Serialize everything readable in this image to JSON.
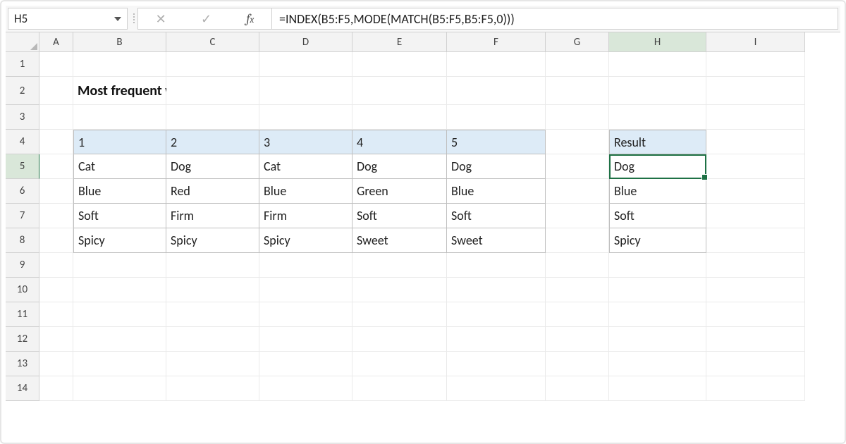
{
  "nameBox": "H5",
  "formula": "=INDEX(B5:F5,MODE(MATCH(B5:F5,B5:F5,0)))",
  "title": "Most frequent word or text",
  "columns": [
    "A",
    "B",
    "C",
    "D",
    "E",
    "F",
    "G",
    "H",
    "I"
  ],
  "activeColumn": "H",
  "rows": [
    "1",
    "2",
    "3",
    "4",
    "5",
    "6",
    "7",
    "8",
    "9",
    "10",
    "11",
    "12",
    "13",
    "14"
  ],
  "activeRow": "5",
  "dataHeaders": [
    "1",
    "2",
    "3",
    "4",
    "5"
  ],
  "data": [
    [
      "Cat",
      "Dog",
      "Cat",
      "Dog",
      "Dog"
    ],
    [
      "Blue",
      "Red",
      "Blue",
      "Green",
      "Blue"
    ],
    [
      "Soft",
      "Firm",
      "Firm",
      "Soft",
      "Soft"
    ],
    [
      "Spicy",
      "Spicy",
      "Spicy",
      "Sweet",
      "Sweet"
    ]
  ],
  "resultHeader": "Result",
  "results": [
    "Dog",
    "Blue",
    "Soft",
    "Spicy"
  ]
}
